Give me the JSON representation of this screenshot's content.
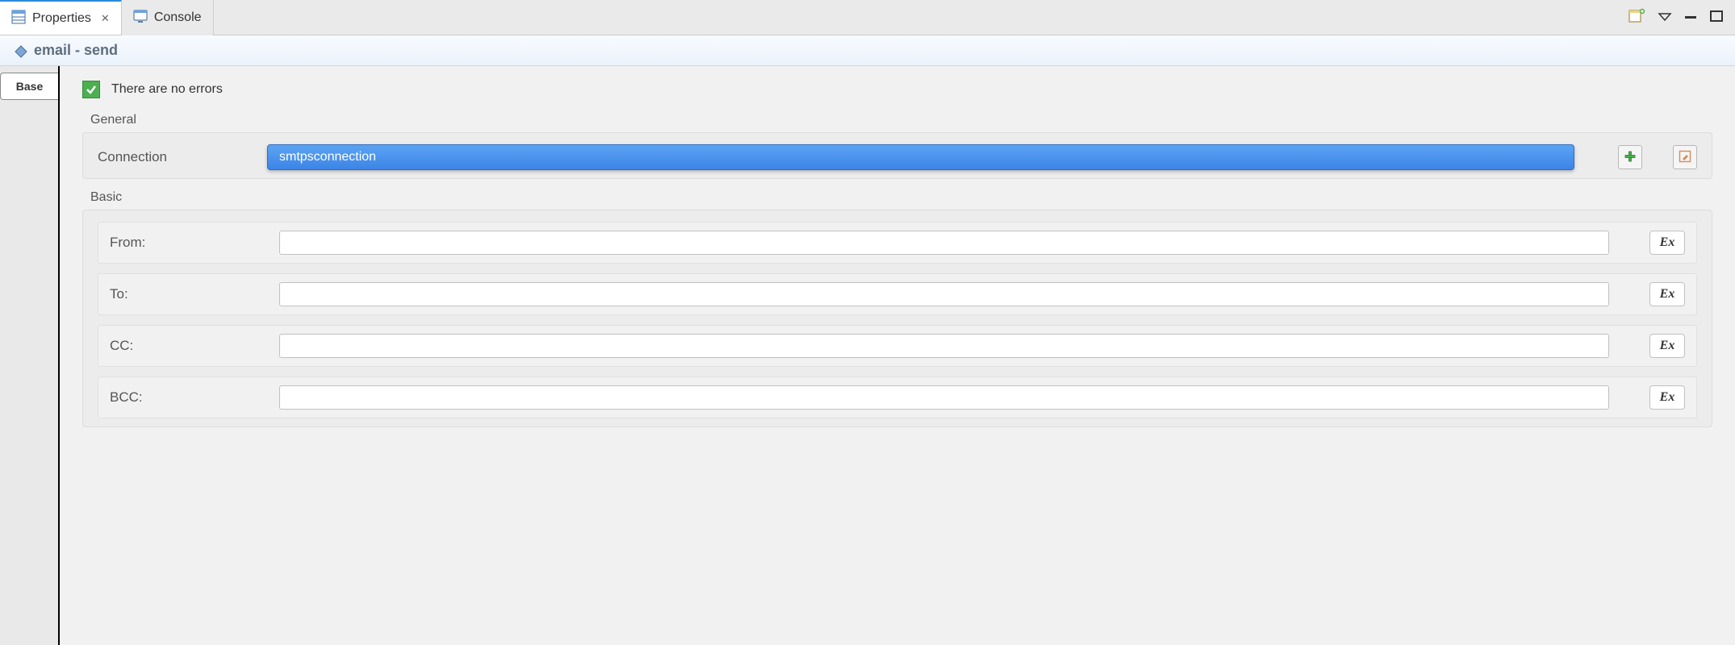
{
  "tabs": [
    {
      "label": "Properties",
      "active": true,
      "closable": true
    },
    {
      "label": "Console",
      "active": false,
      "closable": false
    }
  ],
  "header": {
    "title": "email -  send"
  },
  "side_tabs": [
    {
      "label": "Base"
    }
  ],
  "errors": {
    "message": "There are no errors"
  },
  "sections": {
    "general": {
      "label": "General",
      "connection": {
        "label": "Connection",
        "value": "smtpsconnection"
      }
    },
    "basic": {
      "label": "Basic",
      "fields": [
        {
          "key": "from",
          "label": "From:",
          "value": ""
        },
        {
          "key": "to",
          "label": "To:",
          "value": ""
        },
        {
          "key": "cc",
          "label": "CC:",
          "value": ""
        },
        {
          "key": "bcc",
          "label": "BCC:",
          "value": ""
        }
      ]
    }
  },
  "icons": {
    "expression_label": "Ex"
  }
}
